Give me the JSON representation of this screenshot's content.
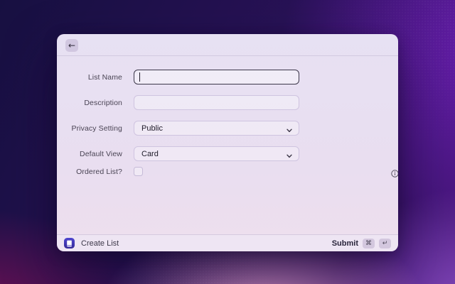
{
  "window": {
    "header": {
      "back_icon": "←"
    },
    "form": {
      "fields": [
        {
          "label": "List Name",
          "type": "text",
          "value": "",
          "placeholder": "",
          "focused": true
        },
        {
          "label": "Description",
          "type": "text",
          "value": "",
          "placeholder": ""
        },
        {
          "label": "Privacy Setting",
          "type": "select",
          "value": "Public"
        },
        {
          "label": "Default View",
          "type": "select",
          "value": "Card"
        },
        {
          "label": "Ordered List?",
          "type": "checkbox",
          "checked": false
        }
      ]
    },
    "footer": {
      "app_icon": "book-icon",
      "title": "Create List",
      "submit_label": "Submit",
      "shortcut_keys": [
        "⌘",
        "↵"
      ]
    },
    "colors": {
      "modal_bg": "#e8e0f2",
      "focus_border": "#3c3749",
      "field_border": "#cfc4e0",
      "app_icon_bg": "#4038b0",
      "bg_top_left": "#171041",
      "bg_top_right": "#6c1fb4",
      "bg_bottom_left": "#7a1055",
      "bg_bottom_center": "#d694c4"
    }
  }
}
